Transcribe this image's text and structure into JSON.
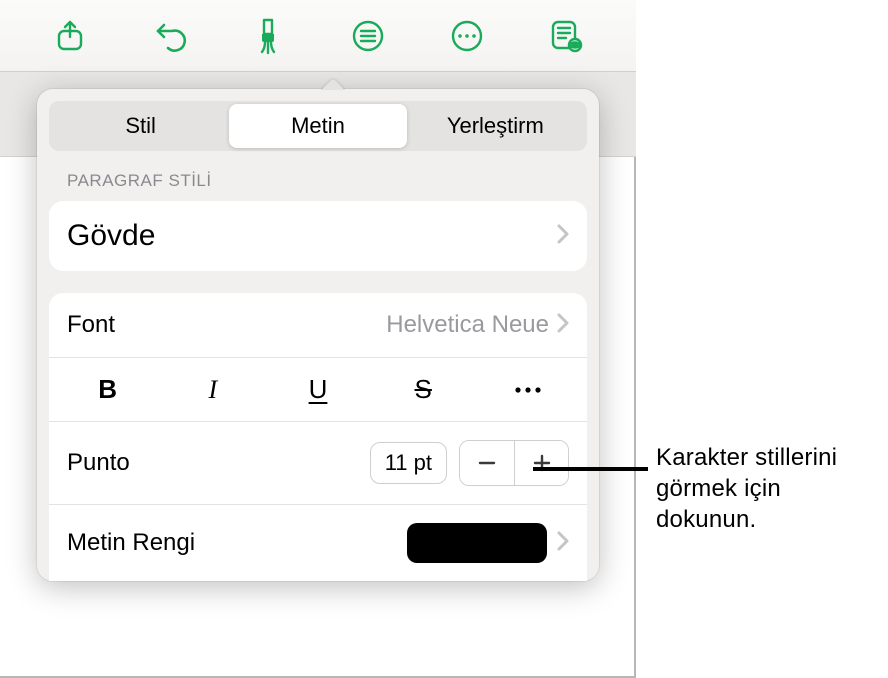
{
  "toolbar": {
    "icons": [
      "share-icon",
      "undo-icon",
      "format-brush-icon",
      "list-icon",
      "more-icon",
      "reading-mode-icon"
    ]
  },
  "tabs": {
    "style": "Stil",
    "text": "Metin",
    "layout": "Yerleştirm"
  },
  "section_label": "PARAGRAF STİLİ",
  "paragraph_style": {
    "value": "Gövde"
  },
  "font_row": {
    "label": "Font",
    "value": "Helvetica Neue"
  },
  "styles": {
    "bold": "B",
    "italic": "I",
    "underline": "U",
    "strike": "S"
  },
  "size_row": {
    "label": "Punto",
    "value": "11 pt"
  },
  "color_row": {
    "label": "Metin Rengi",
    "swatch_color": "#000000"
  },
  "callout": "Karakter stillerini görmek için dokunun."
}
